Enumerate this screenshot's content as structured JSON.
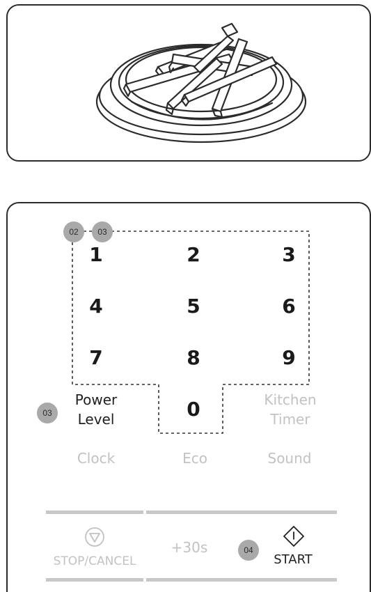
{
  "keypad": {
    "keys": [
      "1",
      "2",
      "3",
      "4",
      "5",
      "6",
      "7",
      "8",
      "9",
      "0"
    ]
  },
  "badges": {
    "b1": "02",
    "b2": "03",
    "b3": "03",
    "b4": "04"
  },
  "labels": {
    "power_level_line1": "Power",
    "power_level_line2": "Level",
    "kitchen_timer_line1": "Kitchen",
    "kitchen_timer_line2": "Timer",
    "clock": "Clock",
    "eco": "Eco",
    "sound": "Sound",
    "stop_cancel": "STOP/CANCEL",
    "plus30": "+30s",
    "start": "START"
  },
  "icons": {
    "stop": "stop-triangle-icon",
    "start": "start-diamond-icon"
  },
  "colors": {
    "active_text": "#1f1f1f",
    "faint_text": "#c2c2c2",
    "badge_bg": "#a9a9a9"
  }
}
